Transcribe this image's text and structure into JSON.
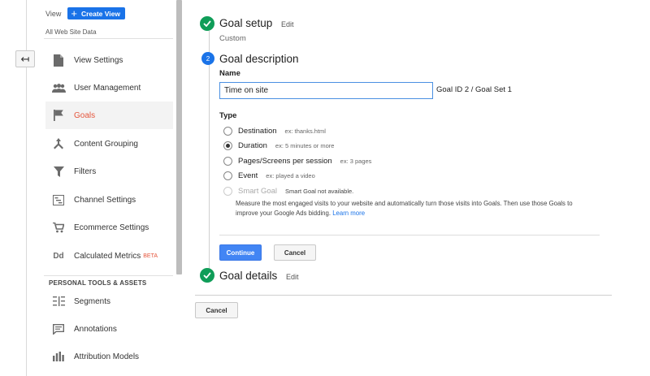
{
  "sidebar": {
    "view_label": "View",
    "create_view_label": "Create View",
    "view_name": "All Web Site Data",
    "items": [
      {
        "label": "View Settings",
        "icon": "document-icon",
        "active": false
      },
      {
        "label": "User Management",
        "icon": "users-icon",
        "active": false
      },
      {
        "label": "Goals",
        "icon": "flag-icon",
        "active": true
      },
      {
        "label": "Content Grouping",
        "icon": "content-grouping-icon",
        "active": false
      },
      {
        "label": "Filters",
        "icon": "filter-icon",
        "active": false
      },
      {
        "label": "Channel Settings",
        "icon": "channel-icon",
        "active": false
      },
      {
        "label": "Ecommerce Settings",
        "icon": "cart-icon",
        "active": false
      },
      {
        "label": "Calculated Metrics",
        "icon": "dd-icon",
        "active": false,
        "badge": "BETA"
      }
    ],
    "section_title": "PERSONAL TOOLS & ASSETS",
    "tools": [
      {
        "label": "Segments",
        "icon": "segments-icon"
      },
      {
        "label": "Annotations",
        "icon": "annotation-icon"
      },
      {
        "label": "Attribution Models",
        "icon": "bar-chart-icon"
      }
    ]
  },
  "goal": {
    "step1": {
      "title": "Goal setup",
      "edit": "Edit",
      "value": "Custom"
    },
    "step2": {
      "number": "2",
      "title": "Goal description",
      "name_label": "Name",
      "name_value": "Time on site",
      "goal_id": "Goal ID 2 / Goal Set 1",
      "type_label": "Type",
      "types": [
        {
          "label": "Destination",
          "example": "ex: thanks.html",
          "checked": false,
          "disabled": false
        },
        {
          "label": "Duration",
          "example": "ex: 5 minutes or more",
          "checked": true,
          "disabled": false
        },
        {
          "label": "Pages/Screens per session",
          "example": "ex: 3 pages",
          "checked": false,
          "disabled": false
        },
        {
          "label": "Event",
          "example": "ex: played a video",
          "checked": false,
          "disabled": false
        },
        {
          "label": "Smart Goal",
          "example": "Smart Goal not available.",
          "checked": false,
          "disabled": true
        }
      ],
      "smart_goal_desc": "Measure the most engaged visits to your website and automatically turn those visits into Goals. Then use those Goals to improve your Google Ads bidding.",
      "learn_more": "Learn more",
      "continue_label": "Continue",
      "cancel_label": "Cancel"
    },
    "step3": {
      "title": "Goal details",
      "edit": "Edit"
    },
    "bottom_cancel_label": "Cancel"
  },
  "colors": {
    "accent": "#1a73e8",
    "success": "#0f9d58",
    "active_nav": "#e5553b"
  }
}
